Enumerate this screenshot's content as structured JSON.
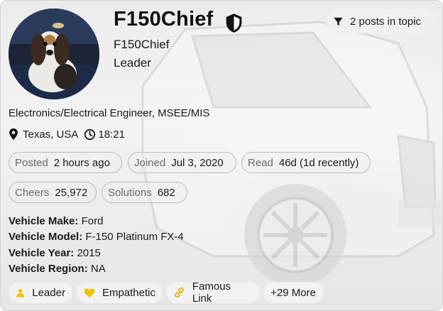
{
  "user": {
    "username": "F150Chief",
    "display_name": "F150Chief",
    "rank": "Leader",
    "title": "Electronics/Electrical Engineer, MSEE/MIS",
    "location": "Texas, USA",
    "local_time": "18:21"
  },
  "topic_button": {
    "label": "2 posts in topic"
  },
  "stats": [
    {
      "label": "Posted",
      "value": "2 hours ago"
    },
    {
      "label": "Joined",
      "value": "Jul 3, 2020"
    },
    {
      "label": "Read",
      "value": "46d (1d recently)"
    },
    {
      "label": "Cheers",
      "value": "25,972"
    },
    {
      "label": "Solutions",
      "value": "682"
    }
  ],
  "vehicle": [
    {
      "label": "Vehicle Make:",
      "value": "Ford"
    },
    {
      "label": "Vehicle Model:",
      "value": "F-150 Platinum FX-4"
    },
    {
      "label": "Vehicle Year:",
      "value": "2015"
    },
    {
      "label": "Vehicle Region:",
      "value": "NA"
    }
  ],
  "badges": [
    {
      "label": "Leader",
      "icon": "person-icon",
      "color": "#f2c200"
    },
    {
      "label": "Empathetic",
      "icon": "heart-icon",
      "color": "#f2c200"
    },
    {
      "label": "Famous Link",
      "icon": "link-icon",
      "color": "#e0b400"
    },
    {
      "label": "+29 More"
    }
  ],
  "colors": {
    "shield": "#111111",
    "accent_yellow": "#f2c200"
  }
}
